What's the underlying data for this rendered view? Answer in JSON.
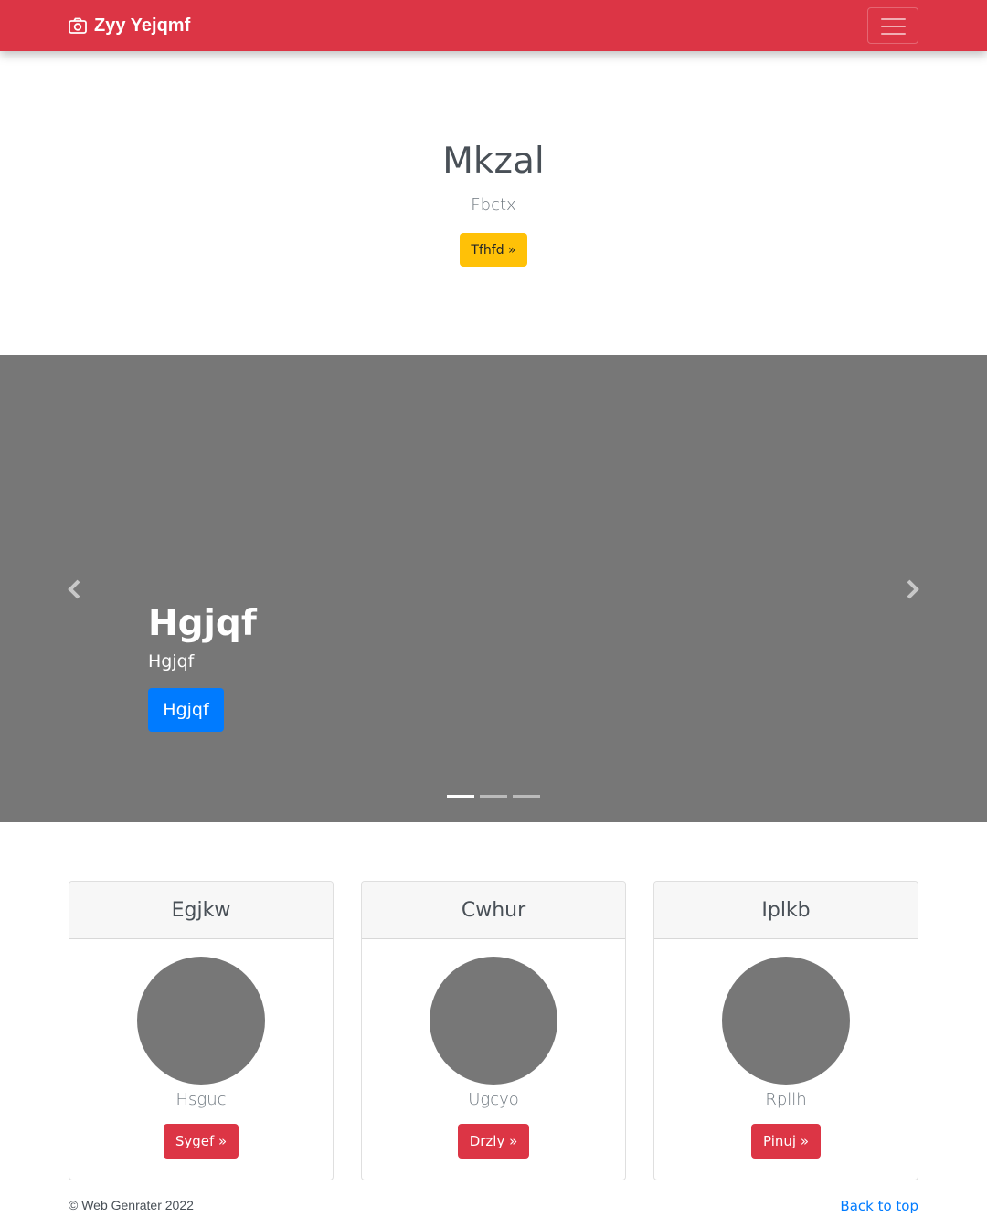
{
  "navbar": {
    "brand": "Zyy Yejqmf",
    "brand_icon": "camera-icon",
    "toggler_icon": "hamburger-menu-icon",
    "color": "#dc3545"
  },
  "hero": {
    "title": "Mkzal",
    "lead": "Fbctx",
    "button_label": "Tfhfd »"
  },
  "carousel": {
    "background": "#777777",
    "slide_title": "Hgjqf",
    "slide_text": "Hgjqf",
    "slide_button": "Hgjqf",
    "prev_icon": "chevron-left-icon",
    "next_icon": "chevron-right-icon",
    "indicator_count": 3,
    "active_indicator": 1
  },
  "cards": [
    {
      "title": "Egjkw",
      "text": "Hsguc",
      "button": "Sygef »"
    },
    {
      "title": "Cwhur",
      "text": "Ugcyo",
      "button": "Drzly »"
    },
    {
      "title": "Iplkb",
      "text": "Rpllh",
      "button": "Pinuj »"
    }
  ],
  "footer": {
    "copyright": "© Web Genrater 2022",
    "back_to_top": "Back to top"
  }
}
